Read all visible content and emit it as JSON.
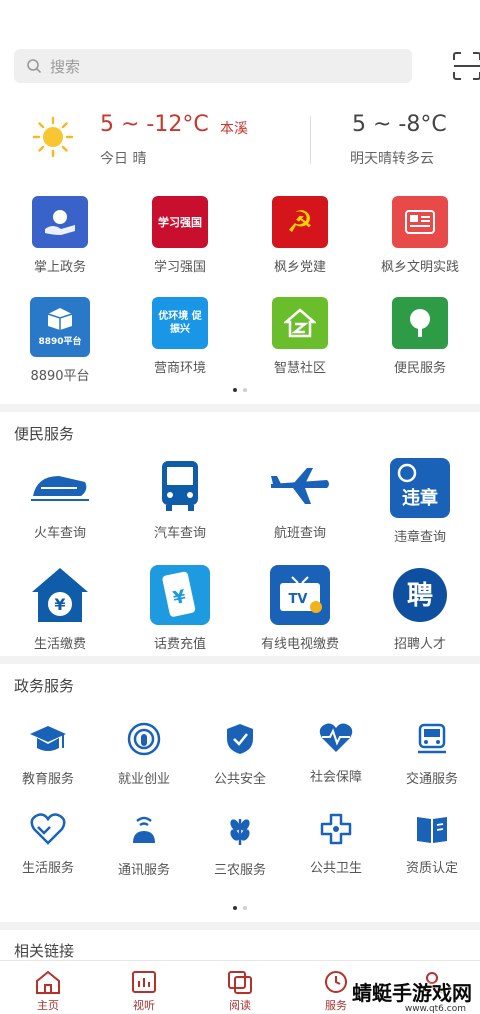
{
  "search": {
    "placeholder": "搜索"
  },
  "weather": {
    "today_temp": "5 ~ -12°C",
    "city": "本溪",
    "today_desc": "今日 晴",
    "tomorrow_temp": "5 ~ -8°C",
    "tomorrow_desc": "明天晴转多云"
  },
  "top_grid": [
    {
      "label": "掌上政务",
      "icon": "hand-logo-icon",
      "color": "#3a63c9",
      "text": ""
    },
    {
      "label": "学习强国",
      "icon": "study-logo-icon",
      "color": "#c8102e",
      "text": "学习强国"
    },
    {
      "label": "枫乡党建",
      "icon": "party-emblem-icon",
      "color": "#d4161c",
      "text": "☭"
    },
    {
      "label": "枫乡文明实践",
      "icon": "newspaper-icon",
      "color": "#e84a4a",
      "text": ""
    },
    {
      "label": "8890平台",
      "icon": "box-icon",
      "color": "#2a78c8",
      "text": "8890平台"
    },
    {
      "label": "营商环境",
      "icon": "business-env-icon",
      "color": "#1996e6",
      "text": "优环境 促振兴"
    },
    {
      "label": "智慧社区",
      "icon": "community-house-icon",
      "color": "#6bbe2b",
      "text": ""
    },
    {
      "label": "便民服务",
      "icon": "tree-icon",
      "color": "#2e9b46",
      "text": ""
    }
  ],
  "convenience": {
    "title": "便民服务",
    "items": [
      {
        "label": "火车查询",
        "icon": "train-icon"
      },
      {
        "label": "汽车查询",
        "icon": "bus-icon"
      },
      {
        "label": "航班查询",
        "icon": "airplane-icon"
      },
      {
        "label": "违章查询",
        "icon": "violation-search-icon",
        "text": "违章"
      },
      {
        "label": "生活缴费",
        "icon": "house-yen-icon",
        "text": "¥"
      },
      {
        "label": "话费充值",
        "icon": "phone-yen-icon",
        "text": "¥"
      },
      {
        "label": "有线电视缴费",
        "icon": "tv-icon",
        "text": "TV"
      },
      {
        "label": "招聘人才",
        "icon": "recruit-icon",
        "text": "聘"
      }
    ]
  },
  "gov": {
    "title": "政务服务",
    "items": [
      {
        "label": "教育服务",
        "icon": "graduation-cap-icon"
      },
      {
        "label": "就业创业",
        "icon": "ear-icon"
      },
      {
        "label": "公共安全",
        "icon": "shield-icon"
      },
      {
        "label": "社会保障",
        "icon": "heart-pulse-icon"
      },
      {
        "label": "交通服务",
        "icon": "car-icon"
      },
      {
        "label": "生活服务",
        "icon": "heart-hand-icon"
      },
      {
        "label": "通讯服务",
        "icon": "signal-icon"
      },
      {
        "label": "三农服务",
        "icon": "wheat-icon"
      },
      {
        "label": "公共卫生",
        "icon": "medical-cross-icon"
      },
      {
        "label": "资质认定",
        "icon": "book-icon"
      }
    ]
  },
  "links": {
    "title": "相关链接"
  },
  "tabbar": [
    {
      "label": "主页",
      "icon": "home-icon"
    },
    {
      "label": "视听",
      "icon": "chart-icon"
    },
    {
      "label": "阅读",
      "icon": "copy-icon"
    },
    {
      "label": "服务",
      "icon": "clock-icon"
    },
    {
      "label": "",
      "icon": "user-icon"
    }
  ],
  "watermark": {
    "name": "蜻蜓手游戏网",
    "url": "www.qt6.com"
  },
  "colors": {
    "accent": "#c8372d",
    "gov_blue": "#1a62b8"
  }
}
